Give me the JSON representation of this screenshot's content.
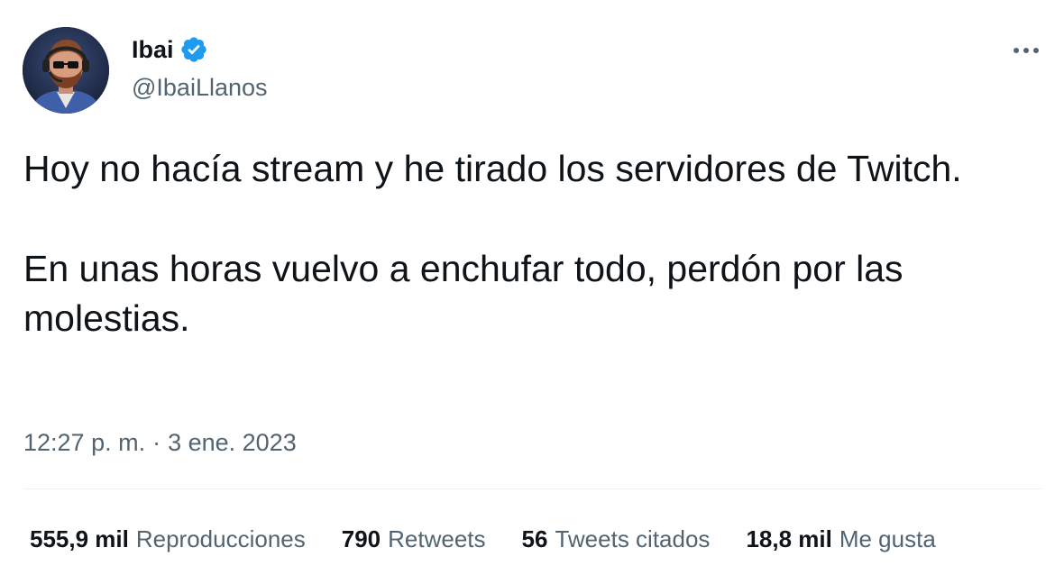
{
  "author": {
    "display_name": "Ibai",
    "handle": "@IbaiLlanos",
    "verified": true,
    "verified_color": "#1d9bf0"
  },
  "more_icon": "more-horizontal-icon",
  "tweet": {
    "paragraphs": [
      "Hoy no hacía stream y he tirado los servidores de Twitch.",
      "En unas horas vuelvo a enchufar todo, perdón por las molestias."
    ],
    "time": "12:27 p. m.",
    "separator": "·",
    "date": "3 ene. 2023"
  },
  "stats": [
    {
      "count": "555,9 mil",
      "label": "Reproducciones"
    },
    {
      "count": "790",
      "label": "Retweets"
    },
    {
      "count": "56",
      "label": "Tweets citados"
    },
    {
      "count": "18,8 mil",
      "label": "Me gusta"
    }
  ],
  "colors": {
    "text_primary": "#0f1419",
    "text_secondary": "#536471",
    "divider": "#eff3f4"
  }
}
